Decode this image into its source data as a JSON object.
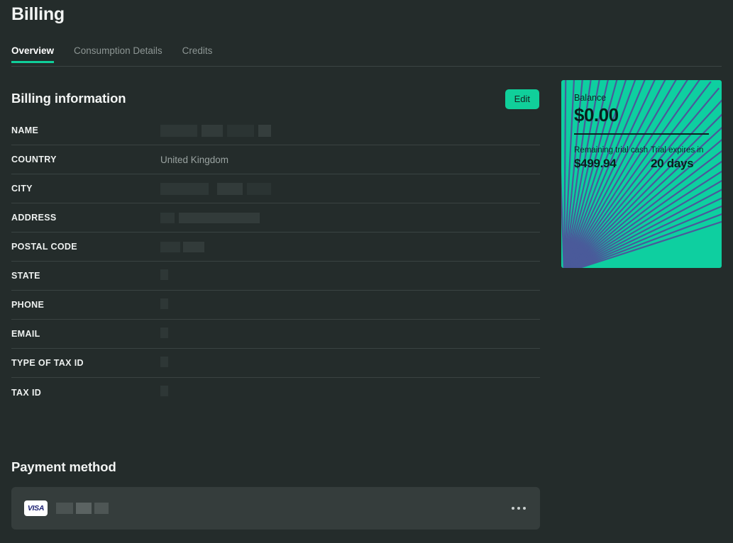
{
  "page": {
    "title": "Billing",
    "background_color": "#242c2b",
    "accent_color": "#10cf9a"
  },
  "tabs": [
    {
      "label": "Overview",
      "active": true
    },
    {
      "label": "Consumption Details",
      "active": false
    },
    {
      "label": "Credits",
      "active": false
    }
  ],
  "billing": {
    "section_title": "Billing information",
    "edit_label": "Edit",
    "rows": [
      {
        "label": "NAME",
        "value": "",
        "redacted": true,
        "segments": [
          52,
          6,
          30,
          6,
          38,
          6,
          18
        ]
      },
      {
        "label": "COUNTRY",
        "value": "United Kingdom",
        "redacted": false,
        "segments": []
      },
      {
        "label": "CITY",
        "value": "",
        "redacted": true,
        "segments": [
          68,
          12,
          36,
          6,
          34
        ]
      },
      {
        "label": "ADDRESS",
        "value": "",
        "redacted": true,
        "segments": [
          20,
          6,
          114
        ]
      },
      {
        "label": "POSTAL CODE",
        "value": "",
        "redacted": true,
        "segments": [
          28,
          4,
          30
        ]
      },
      {
        "label": "STATE",
        "value": "",
        "redacted": true,
        "segments": [
          11
        ]
      },
      {
        "label": "PHONE",
        "value": "",
        "redacted": true,
        "segments": [
          11
        ]
      },
      {
        "label": "EMAIL",
        "value": "",
        "redacted": true,
        "segments": [
          11
        ]
      },
      {
        "label": "TYPE OF TAX ID",
        "value": "",
        "redacted": true,
        "segments": [
          11
        ]
      },
      {
        "label": "TAX ID",
        "value": "",
        "redacted": true,
        "segments": [
          11
        ]
      }
    ]
  },
  "balance_card": {
    "background_color": "#0ecfa0",
    "pattern_color": "#4a5a9a",
    "balance_label": "Balance",
    "balance_amount": "$0.00",
    "trial_cash_label": "Remaining trial cash",
    "trial_cash_value": "$499.94",
    "trial_expiry_label": "Trial expires in",
    "trial_expiry_value": "20 days"
  },
  "payment": {
    "section_title": "Payment method",
    "card_brand": "VISA",
    "card_number_redacted": true,
    "card_segments": [
      24,
      4,
      22,
      4,
      20
    ],
    "menu_icon": "ellipsis-icon"
  }
}
